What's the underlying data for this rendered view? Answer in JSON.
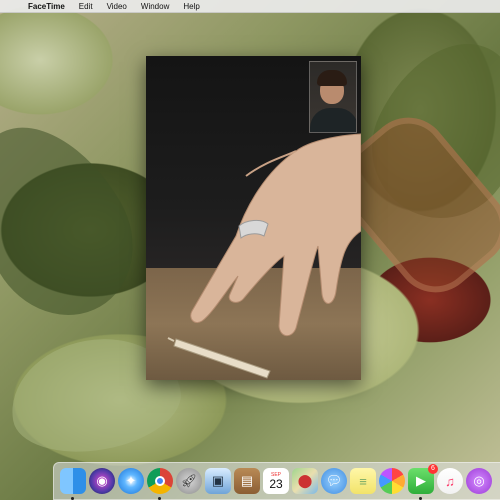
{
  "menubar": {
    "apple_icon": "apple-icon",
    "app_name": "FaceTime",
    "items": [
      "Edit",
      "Video",
      "Window",
      "Help"
    ]
  },
  "facetime_window": {
    "remote_video": "remote-video-feed",
    "self_view": "self-view-camera"
  },
  "dock": {
    "items": [
      {
        "name": "finder",
        "icon": "finder-icon",
        "running": true
      },
      {
        "name": "siri",
        "icon": "siri-icon"
      },
      {
        "name": "safari",
        "icon": "safari-icon"
      },
      {
        "name": "chrome",
        "icon": "chrome-icon",
        "running": true
      },
      {
        "name": "launchpad",
        "icon": "rocket-icon"
      },
      {
        "name": "preview",
        "icon": "preview-icon"
      },
      {
        "name": "notebook",
        "icon": "notebook-icon"
      },
      {
        "name": "calendar",
        "icon": "calendar-icon",
        "month": "SEP",
        "day": "23"
      },
      {
        "name": "maps",
        "icon": "maps-icon"
      },
      {
        "name": "messages",
        "icon": "messages-icon"
      },
      {
        "name": "stickies",
        "icon": "stickies-icon"
      },
      {
        "name": "photos",
        "icon": "photos-icon"
      },
      {
        "name": "facetime",
        "icon": "facetime-icon",
        "badge": "6",
        "running": true
      },
      {
        "name": "music",
        "icon": "music-icon"
      },
      {
        "name": "podcasts",
        "icon": "podcasts-icon"
      }
    ]
  },
  "colors": {
    "menubar_bg": "#ececec",
    "window_bg": "#1b1b1b",
    "facetime_green": "#2fae3a",
    "badge_red": "#ff3333"
  }
}
